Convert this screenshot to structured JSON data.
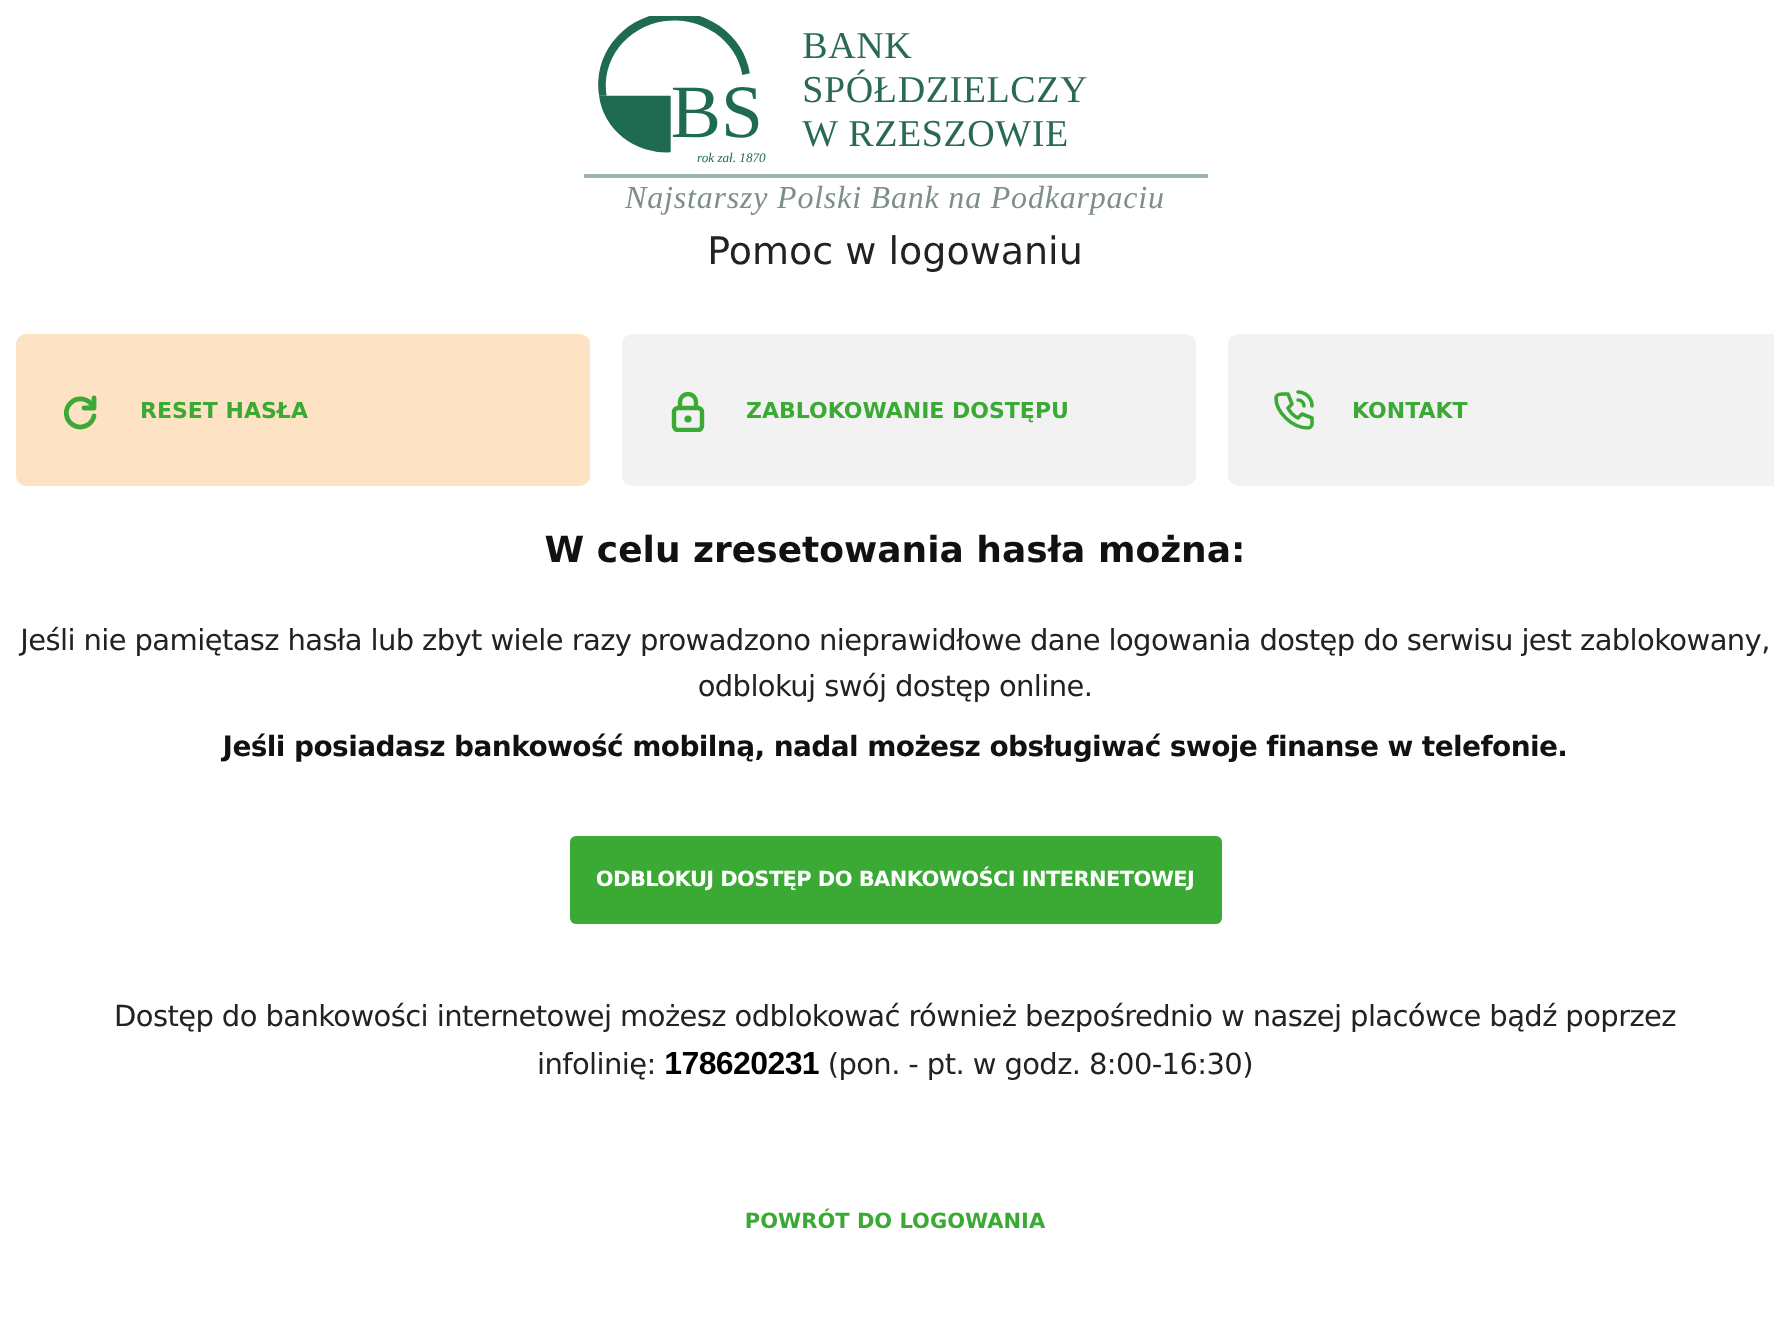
{
  "logo": {
    "monogram": "BS",
    "founded": "rok zał. 1870",
    "name_lines": [
      "BANK SPÓŁDZIELCZY",
      "W RZESZOWIE"
    ],
    "motto": "Najstarszy Polski Bank na Podkarpaciu"
  },
  "page_title": "Pomoc w logowaniu",
  "tabs": [
    {
      "kind": "reset",
      "label": "RESET HASŁA",
      "selected": true
    },
    {
      "kind": "lock",
      "label": "ZABLOKOWANIE DOSTĘPU",
      "selected": false
    },
    {
      "kind": "phone",
      "label": "KONTAKT",
      "selected": false
    }
  ],
  "heading": "W celu zresetowania hasła można:",
  "info": "Jeśli nie pamiętasz hasła lub zbyt wiele razy prowadzono nieprawidłowe dane logowania dostęp do serwisu jest zablokowany, odblokuj swój dostęp online.",
  "mobile_note": "Jeśli posiadasz bankowość mobilną, nadal możesz obsługiwać swoje finanse w telefonie.",
  "unlock_button": "ODBLOKUJ DOSTĘP DO BANKOWOŚCI INTERNETOWEJ",
  "branch_note": "Dostęp do bankowości internetowej możesz odblokować również bezpośrednio w naszej placówce bądź poprzez infolinię:  **178620231** (pon. - pt. w godz. 8:00-16:30)",
  "back_link": "POWRÓT DO LOGOWANIA"
}
